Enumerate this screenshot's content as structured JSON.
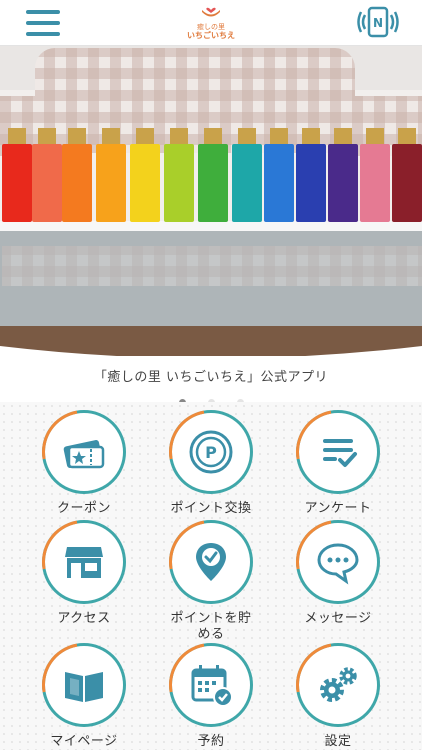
{
  "header": {
    "menu_icon": "hamburger-icon",
    "logo_line1": "癒しの里",
    "logo_line2": "いちごいちえ",
    "nfc_icon": "nfc-phone-icon"
  },
  "hero": {
    "image": "colorful perfume bottles on glass table"
  },
  "subtitle": "「癒しの里 いちごいちえ」公式アプリ",
  "carousel": {
    "page_count": 3,
    "active_index": 0
  },
  "colors": {
    "accent": "#3b8fa8",
    "teal": "#3fa7a9",
    "orange": "#ef8a3a"
  },
  "menu": [
    {
      "label": "クーポン",
      "icon": "ticket-icon"
    },
    {
      "label": "ポイント交換",
      "icon": "point-coin-icon"
    },
    {
      "label": "アンケート",
      "icon": "survey-icon"
    },
    {
      "label": "アクセス",
      "icon": "shop-icon"
    },
    {
      "label": "ポイントを貯める",
      "icon": "location-pin-icon"
    },
    {
      "label": "メッセージ",
      "icon": "chat-bubble-icon"
    },
    {
      "label": "マイページ",
      "icon": "book-icon"
    },
    {
      "label": "予約",
      "icon": "calendar-icon"
    },
    {
      "label": "設定",
      "icon": "gears-icon"
    }
  ]
}
